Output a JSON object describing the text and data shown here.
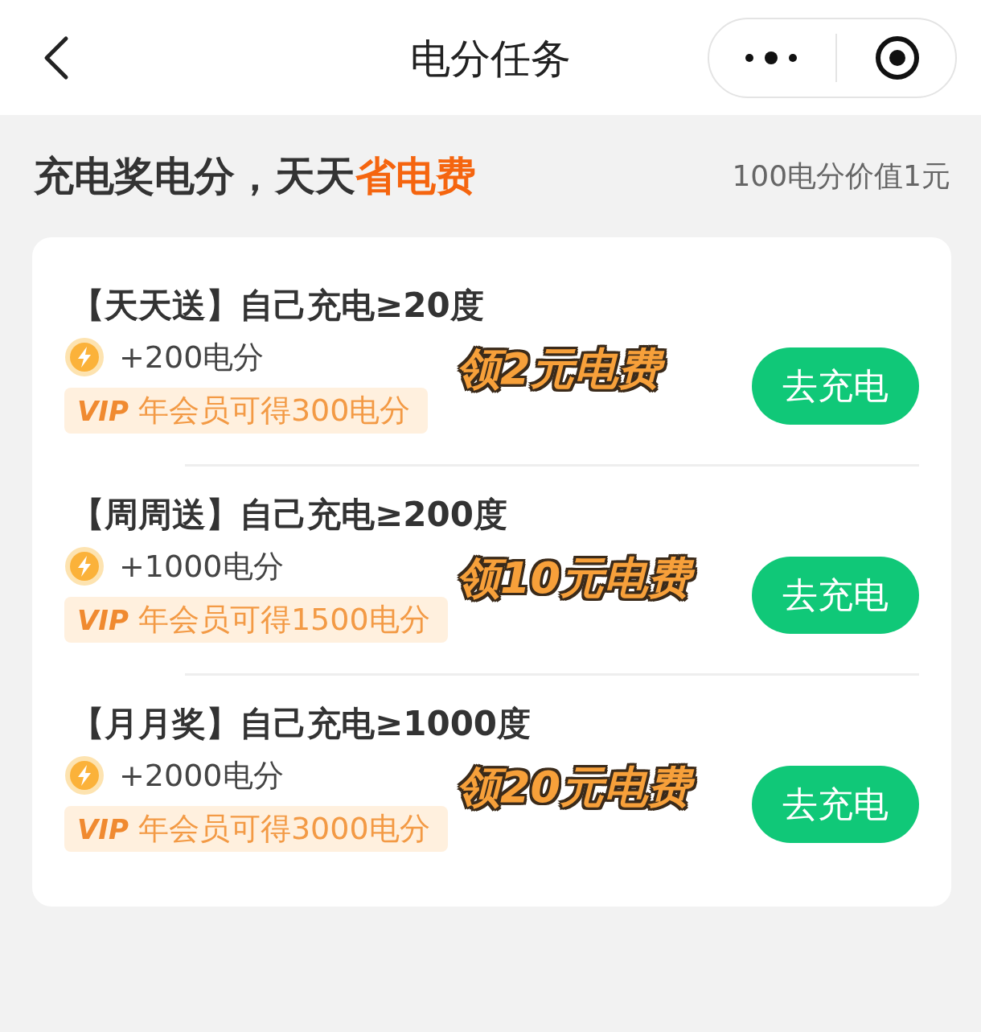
{
  "nav": {
    "title": "电分任务"
  },
  "headline": {
    "text": "充电奖电分，天天",
    "highlight": "省电费",
    "note": "100电分价值1元"
  },
  "tasks": [
    {
      "title": "【天天送】自己充电≥20度",
      "points": "+200电分",
      "vip_mark": "VIP",
      "vip": "年会员可得300电分",
      "reward": "领2元电费",
      "button": "去充电"
    },
    {
      "title": "【周周送】自己充电≥200度",
      "points": "+1000电分",
      "vip_mark": "VIP",
      "vip": "年会员可得1500电分",
      "reward": "领10元电费",
      "button": "去充电"
    },
    {
      "title": "【月月奖】自己充电≥1000度",
      "points": "+2000电分",
      "vip_mark": "VIP",
      "vip": "年会员可得3000电分",
      "reward": "领20元电费",
      "button": "去充电"
    }
  ]
}
